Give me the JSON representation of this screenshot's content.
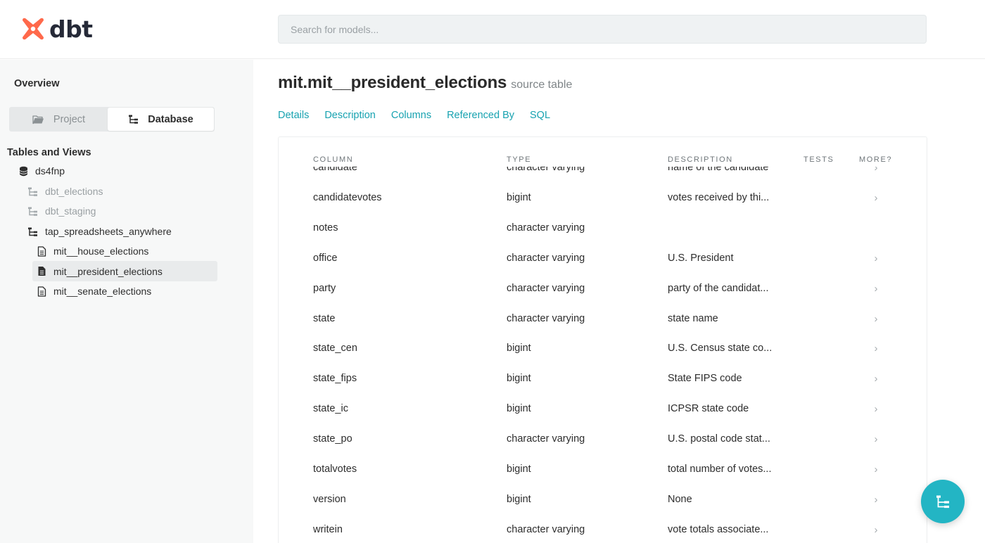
{
  "header": {
    "logo_text": "dbt",
    "search_placeholder": "Search for models..."
  },
  "sidebar": {
    "overview_label": "Overview",
    "toggle": {
      "project_label": "Project",
      "database_label": "Database",
      "active": "Database"
    },
    "section_title": "Tables and Views",
    "tree": [
      {
        "label": "ds4fnp",
        "icon": "database-icon",
        "level": 0,
        "muted": false,
        "active": false
      },
      {
        "label": "dbt_elections",
        "icon": "schema-tree-icon",
        "level": 1,
        "muted": true,
        "active": false
      },
      {
        "label": "dbt_staging",
        "icon": "schema-tree-icon",
        "level": 1,
        "muted": true,
        "active": false
      },
      {
        "label": "tap_spreadsheets_anywhere",
        "icon": "schema-tree-icon",
        "level": 1,
        "muted": false,
        "active": false
      },
      {
        "label": "mit__house_elections",
        "icon": "document-icon",
        "level": 2,
        "muted": false,
        "active": false
      },
      {
        "label": "mit__president_elections",
        "icon": "document-filled-icon",
        "level": 2,
        "muted": false,
        "active": true
      },
      {
        "label": "mit__senate_elections",
        "icon": "document-icon",
        "level": 2,
        "muted": false,
        "active": false
      }
    ]
  },
  "main": {
    "title": "mit.mit__president_elections",
    "subtitle": "source table",
    "tabs": [
      "Details",
      "Description",
      "Columns",
      "Referenced By",
      "SQL"
    ],
    "table": {
      "headers": {
        "column": "COLUMN",
        "type": "TYPE",
        "description": "DESCRIPTION",
        "tests": "TESTS",
        "more": "MORE?"
      },
      "rows": [
        {
          "name": "candidate",
          "type": "character varying",
          "description": "name of the candidate",
          "more": "›"
        },
        {
          "name": "candidatevotes",
          "type": "bigint",
          "description": "votes received by thi...",
          "more": "›"
        },
        {
          "name": "notes",
          "type": "character varying",
          "description": "",
          "more": ""
        },
        {
          "name": "office",
          "type": "character varying",
          "description": "U.S. President",
          "more": "›"
        },
        {
          "name": "party",
          "type": "character varying",
          "description": "party of the candidat...",
          "more": "›"
        },
        {
          "name": "state",
          "type": "character varying",
          "description": "state name",
          "more": "›"
        },
        {
          "name": "state_cen",
          "type": "bigint",
          "description": "U.S. Census state co...",
          "more": "›"
        },
        {
          "name": "state_fips",
          "type": "bigint",
          "description": "State FIPS code",
          "more": "›"
        },
        {
          "name": "state_ic",
          "type": "bigint",
          "description": "ICPSR state code",
          "more": "›"
        },
        {
          "name": "state_po",
          "type": "character varying",
          "description": "U.S. postal code stat...",
          "more": "›"
        },
        {
          "name": "totalvotes",
          "type": "bigint",
          "description": "total number of votes...",
          "more": "›"
        },
        {
          "name": "version",
          "type": "bigint",
          "description": "None",
          "more": "›"
        },
        {
          "name": "writein",
          "type": "character varying",
          "description": "vote totals associate...",
          "more": "›"
        }
      ]
    }
  },
  "fab": {
    "icon": "lineage-graph-icon"
  },
  "colors": {
    "brand_orange": "#ff694b",
    "accent_teal": "#17a2b0",
    "fab_teal": "#23b5c4",
    "sidebar_bg": "#f7f8f8"
  }
}
